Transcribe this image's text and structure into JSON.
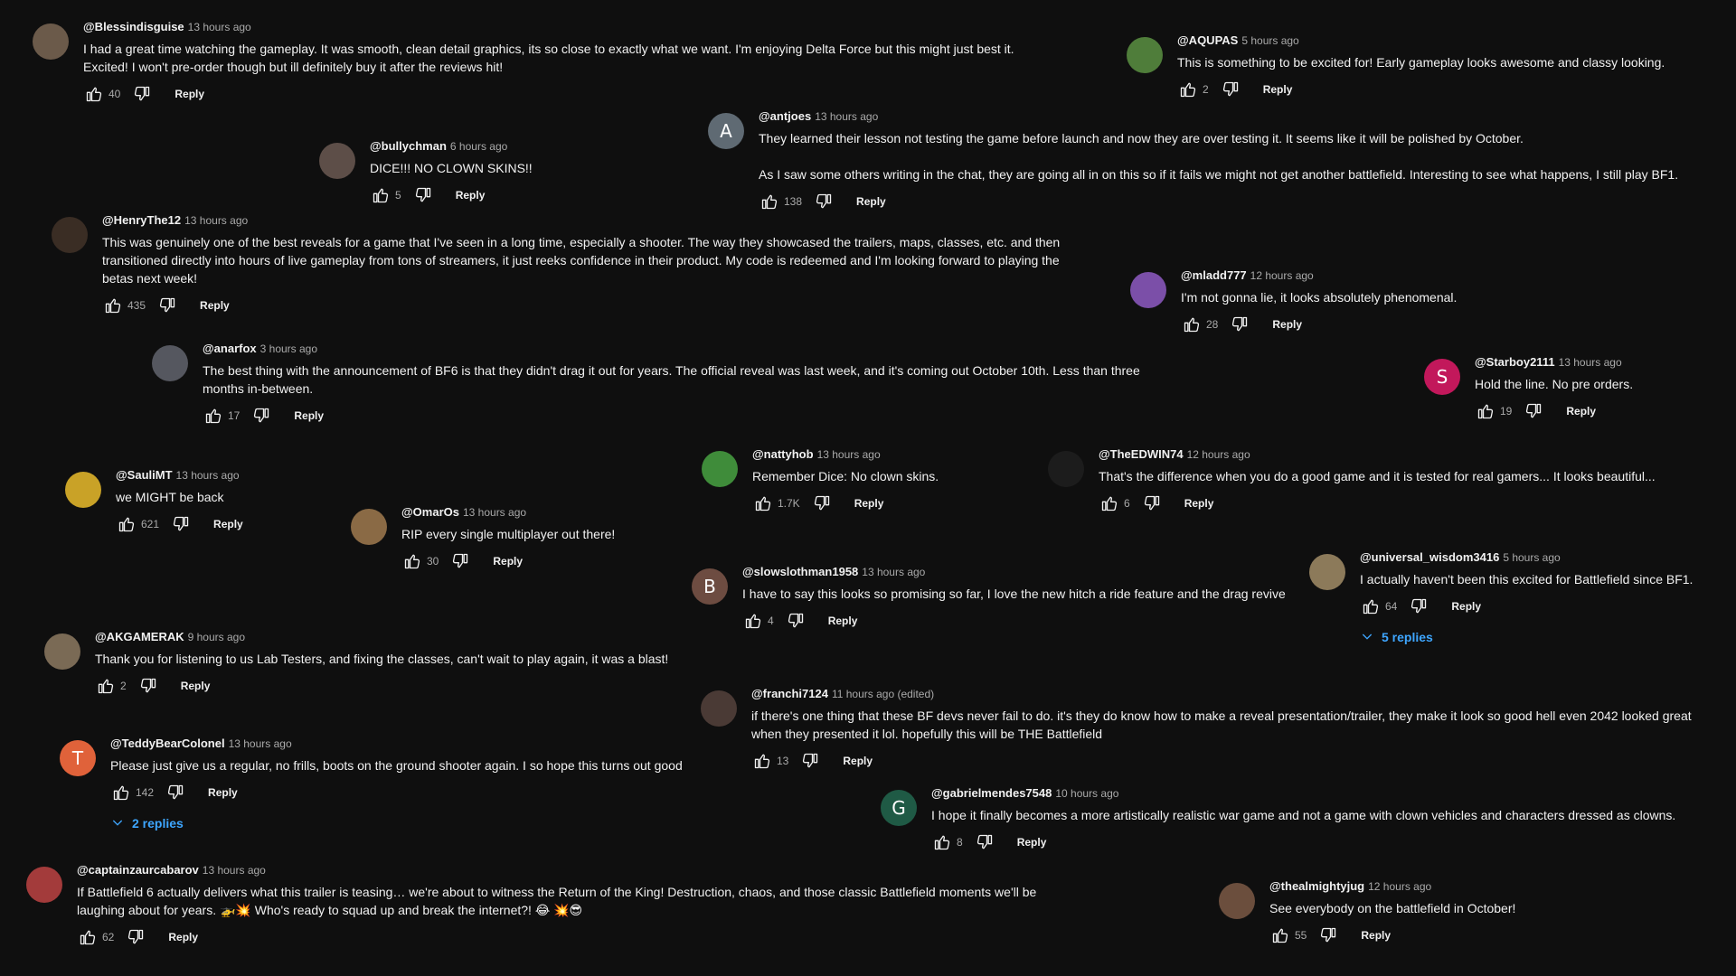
{
  "reply_label": "Reply",
  "comments": [
    {
      "author": "@Blessindisguise",
      "time": "13 hours ago",
      "text": [
        "I had a great time watching the gameplay. It was smooth, clean detail graphics, its so close to exactly what we want. I'm enjoying Delta Force but this might just best it. Excited! I won't pre-order though but ill definitely buy it after the reviews hit!"
      ],
      "likes": "40",
      "avatar": {
        "letter": "",
        "color": "#6b5a4a"
      }
    },
    {
      "author": "@AQUPAS",
      "time": "5 hours ago",
      "text": [
        "This is something to be excited for! Early gameplay looks awesome and classy looking."
      ],
      "likes": "2",
      "avatar": {
        "letter": "",
        "color": "#4f7d3a"
      }
    },
    {
      "author": "@antjoes",
      "time": "13 hours ago",
      "text": [
        "They learned their lesson not testing the game before launch and now they are over testing it. It seems like it will be polished by October.",
        "As I saw some others writing in the chat, they are going all in on this so if it fails we might not get another battlefield. Interesting to see what happens, I still play BF1."
      ],
      "likes": "138",
      "avatar": {
        "letter": "A",
        "color": "#5f6a73"
      }
    },
    {
      "author": "@bullychman",
      "time": "6 hours ago",
      "text": [
        "DICE!!! NO CLOWN SKINS!!"
      ],
      "likes": "5",
      "avatar": {
        "letter": "",
        "color": "#5d4e48"
      }
    },
    {
      "author": "@HenryThe12",
      "time": "13 hours ago",
      "text": [
        "This was genuinely one of the best reveals for a game that I've seen in a long time, especially a shooter. The way they showcased the trailers, maps, classes, etc. and then transitioned directly into hours of live gameplay from tons of streamers, it just reeks confidence in their product. My code is redeemed and I'm looking forward to playing the betas next week!"
      ],
      "likes": "435",
      "avatar": {
        "letter": "",
        "color": "#3a2d24"
      }
    },
    {
      "author": "@mladd777",
      "time": "12 hours ago",
      "text": [
        "I'm not gonna lie, it looks absolutely phenomenal."
      ],
      "likes": "28",
      "avatar": {
        "letter": "",
        "color": "#7b4fa8"
      }
    },
    {
      "author": "@anarfox",
      "time": "3 hours ago",
      "text": [
        "The best thing with the announcement of BF6 is that they didn't drag it out for years. The official reveal was last week, and it's coming out October 10th. Less than three months in-between."
      ],
      "likes": "17",
      "avatar": {
        "letter": "",
        "color": "#55575f"
      }
    },
    {
      "author": "@Starboy2111",
      "time": "13 hours ago",
      "text": [
        "Hold the line. No pre orders."
      ],
      "likes": "19",
      "avatar": {
        "letter": "S",
        "color": "#c2185b"
      }
    },
    {
      "author": "@nattyhob",
      "time": "13 hours ago",
      "text": [
        "Remember Dice: No clown skins."
      ],
      "likes": "1.7K",
      "avatar": {
        "letter": "",
        "color": "#3f8c3a"
      }
    },
    {
      "author": "@TheEDWIN74",
      "time": "12 hours ago",
      "text": [
        "That's the difference when you do a good game and it is tested for real gamers... It looks beautiful..."
      ],
      "likes": "6",
      "avatar": {
        "letter": "",
        "color": "#1c1c1c"
      }
    },
    {
      "author": "@SauliMT",
      "time": "13 hours ago",
      "text": [
        "we MIGHT be back"
      ],
      "likes": "621",
      "avatar": {
        "letter": "",
        "color": "#c9a227"
      }
    },
    {
      "author": "@OmarOs",
      "time": "13 hours ago",
      "text": [
        "RIP every single multiplayer out there!"
      ],
      "likes": "30",
      "avatar": {
        "letter": "",
        "color": "#8a6a45"
      }
    },
    {
      "author": "@slowslothman1958",
      "time": "13 hours ago",
      "text": [
        "I have to say this looks so promising so far, I love the new hitch a ride feature and the drag revive"
      ],
      "likes": "4",
      "avatar": {
        "letter": "B",
        "color": "#6d4c41"
      }
    },
    {
      "author": "@universal_wisdom3416",
      "time": "5 hours ago",
      "text": [
        "I actually haven't been this excited for Battlefield since BF1."
      ],
      "likes": "64",
      "avatar": {
        "letter": "",
        "color": "#8c7a5a"
      },
      "replies": "5 replies"
    },
    {
      "author": "@AKGAMERAK",
      "time": "9 hours ago",
      "text": [
        "Thank you for listening to us Lab Testers, and fixing the classes,  can't wait to play again, it was a blast!"
      ],
      "likes": "2",
      "avatar": {
        "letter": "",
        "color": "#7a6a55"
      }
    },
    {
      "author": "@franchi7124",
      "time": "11 hours ago (edited)",
      "text": [
        "if there's one thing that these BF devs never fail to do. it's they do know how to make a reveal presentation/trailer, they make it look so good hell even 2042 looked great when they presented it lol. hopefully this will be THE Battlefield"
      ],
      "likes": "13",
      "avatar": {
        "letter": "",
        "color": "#4a3a35"
      }
    },
    {
      "author": "@TeddyBearColonel",
      "time": "13 hours ago",
      "text": [
        "Please just give us a regular, no frills, boots on the ground shooter again. I so hope this turns out good"
      ],
      "likes": "142",
      "avatar": {
        "letter": "T",
        "color": "#e0623a"
      },
      "replies": "2 replies"
    },
    {
      "author": "@gabrielmendes7548",
      "time": "10 hours ago",
      "text": [
        "I hope it finally becomes a more artistically realistic war game and not a game with clown vehicles and characters dressed as clowns."
      ],
      "likes": "8",
      "avatar": {
        "letter": "G",
        "color": "#1f5a45"
      }
    },
    {
      "author": "@captainzaurcabarov",
      "time": "13 hours ago",
      "text": [
        "If Battlefield 6 actually delivers what this trailer is teasing… we're about to witness the Return of the King! Destruction, chaos, and those classic Battlefield moments we'll be laughing about for years. 🚁💥 Who's ready to squad up and break the internet?! 😂 💥😎"
      ],
      "likes": "62",
      "avatar": {
        "letter": "",
        "color": "#a33b3b"
      }
    },
    {
      "author": "@thealmightyjug",
      "time": "12 hours ago",
      "text": [
        "See everybody on the battlefield in October!"
      ],
      "likes": "55",
      "avatar": {
        "letter": "",
        "color": "#6b4e3d"
      }
    }
  ]
}
